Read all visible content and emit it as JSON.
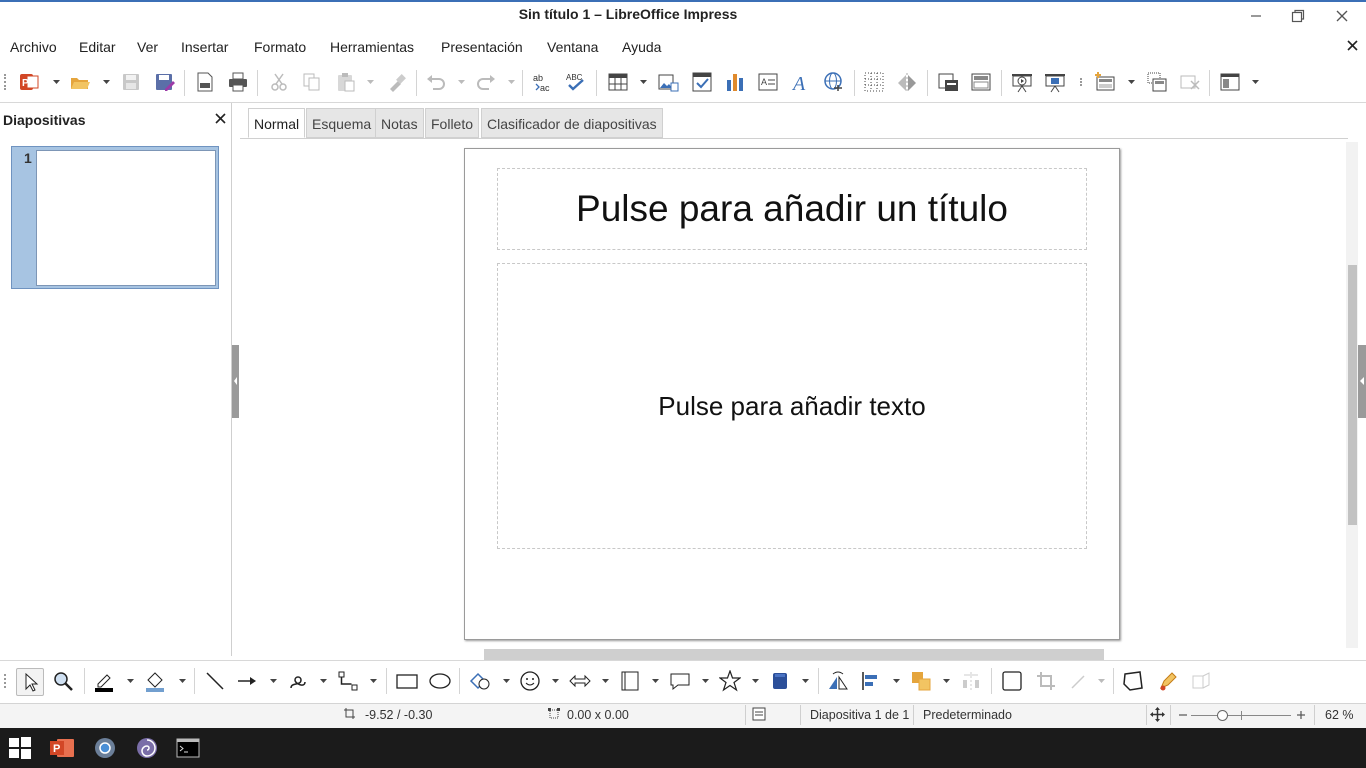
{
  "window": {
    "title": "Sin título 1 – LibreOffice Impress"
  },
  "menu": [
    "Archivo",
    "Editar",
    "Ver",
    "Insertar",
    "Formato",
    "Herramientas",
    "Presentación",
    "Ventana",
    "Ayuda"
  ],
  "slides_pane": {
    "title": "Diapositivas",
    "thumbnails": [
      {
        "number": "1"
      }
    ]
  },
  "tabs": [
    "Normal",
    "Esquema",
    "Notas",
    "Folleto",
    "Clasificador de diapositivas"
  ],
  "active_tab": "Normal",
  "slide": {
    "title_placeholder": "Pulse para añadir un título",
    "body_placeholder": "Pulse para añadir texto"
  },
  "status": {
    "position": "-9.52 / -0.30",
    "size": "0.00 x 0.00",
    "slide_info": "Diapositiva 1 de 1",
    "master": "Predeterminado",
    "zoom": "62 %"
  },
  "colors": {
    "accent": "#3b6fb6",
    "selected_thumb": "#a7c4e2",
    "taskbar": "#1b1b1b",
    "impress_red": "#d24726"
  }
}
